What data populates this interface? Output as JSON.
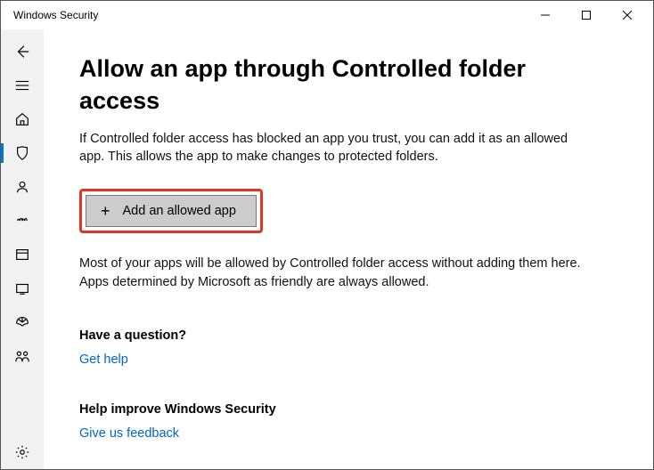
{
  "window": {
    "title": "Windows Security"
  },
  "page": {
    "title": "Allow an app through Controlled folder access",
    "intro": "If Controlled folder access has blocked an app you trust, you can add it as an allowed app. This allows the app to make changes to protected folders.",
    "add_button": "Add an allowed app",
    "note": "Most of your apps will be allowed by Controlled folder access without adding them here. Apps determined by Microsoft as friendly are always allowed.",
    "question_heading": "Have a question?",
    "get_help": "Get help",
    "improve_heading": "Help improve Windows Security",
    "feedback": "Give us feedback"
  }
}
